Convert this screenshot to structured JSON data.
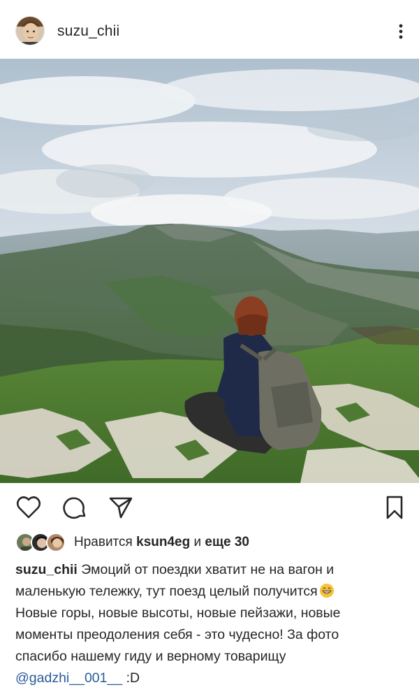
{
  "header": {
    "username": "suzu_chii",
    "avatar_icon": "profile-avatar",
    "more_icon": "more-vertical-icon"
  },
  "post": {
    "image_icon": "mountain-landscape-photo"
  },
  "actions": {
    "like_icon": "heart-icon",
    "comment_icon": "comment-icon",
    "share_icon": "send-icon",
    "save_icon": "bookmark-icon"
  },
  "likes": {
    "prefix": "Нравится",
    "user": "ksun4eg",
    "joiner": "и",
    "more": "еще 30"
  },
  "caption": {
    "username": "suzu_chii",
    "line1": "Эмоций от поездки хватит не на вагон и",
    "line2": "маленькую тележку, тут поезд целый получится",
    "line3": "Новые горы, новые высоты, новые пейзажи, новые",
    "line4": "моменты преодоления себя - это чудесно!  За фото",
    "line5": "спасибо нашему гиду и верному товарищу",
    "mention": "@gadzhi__001__",
    "suffix": " :D",
    "emoji_icon": "grinning-emoji-icon"
  },
  "colors": {
    "text": "#262626",
    "mention": "#2a5a99",
    "background": "#ffffff"
  }
}
